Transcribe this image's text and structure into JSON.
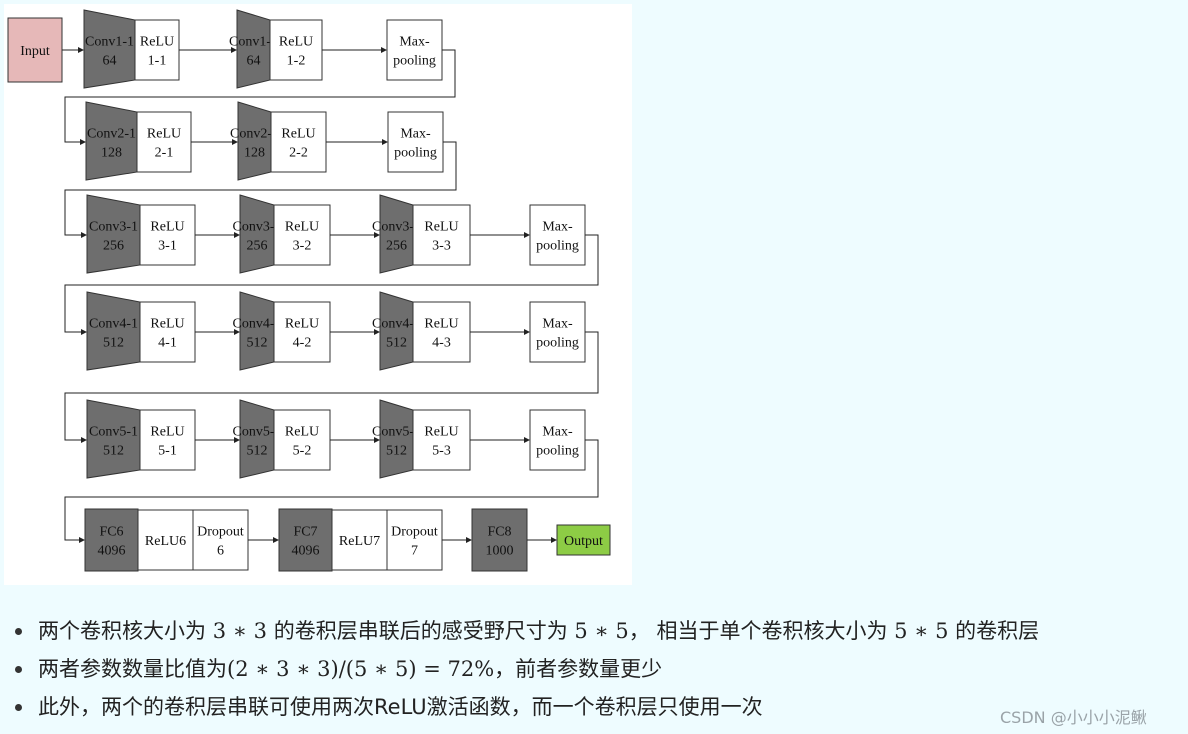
{
  "diagram": {
    "rows": [
      [
        {
          "type": "input",
          "lines": [
            "Input"
          ]
        },
        {
          "type": "conv",
          "lines": [
            "Conv1-1",
            "64"
          ]
        },
        {
          "type": "relu",
          "lines": [
            "ReLU",
            "1-1"
          ]
        },
        {
          "type": "conv",
          "lines": [
            "Conv1-2",
            "64"
          ]
        },
        {
          "type": "relu",
          "lines": [
            "ReLU",
            "1-2"
          ]
        },
        {
          "type": "pool",
          "lines": [
            "Max-",
            "pooling"
          ]
        }
      ],
      [
        {
          "type": "conv",
          "lines": [
            "Conv2-1",
            "128"
          ]
        },
        {
          "type": "relu",
          "lines": [
            "ReLU",
            "2-1"
          ]
        },
        {
          "type": "conv",
          "lines": [
            "Conv2-2",
            "128"
          ]
        },
        {
          "type": "relu",
          "lines": [
            "ReLU",
            "2-2"
          ]
        },
        {
          "type": "pool",
          "lines": [
            "Max-",
            "pooling"
          ]
        }
      ],
      [
        {
          "type": "conv",
          "lines": [
            "Conv3-1",
            "256"
          ]
        },
        {
          "type": "relu",
          "lines": [
            "ReLU",
            "3-1"
          ]
        },
        {
          "type": "conv",
          "lines": [
            "Conv3-2",
            "256"
          ]
        },
        {
          "type": "relu",
          "lines": [
            "ReLU",
            "3-2"
          ]
        },
        {
          "type": "conv",
          "lines": [
            "Conv3-3",
            "256"
          ]
        },
        {
          "type": "relu",
          "lines": [
            "ReLU",
            "3-3"
          ]
        },
        {
          "type": "pool",
          "lines": [
            "Max-",
            "pooling"
          ]
        }
      ],
      [
        {
          "type": "conv",
          "lines": [
            "Conv4-1",
            "512"
          ]
        },
        {
          "type": "relu",
          "lines": [
            "ReLU",
            "4-1"
          ]
        },
        {
          "type": "conv",
          "lines": [
            "Conv4-2",
            "512"
          ]
        },
        {
          "type": "relu",
          "lines": [
            "ReLU",
            "4-2"
          ]
        },
        {
          "type": "conv",
          "lines": [
            "Conv4-3",
            "512"
          ]
        },
        {
          "type": "relu",
          "lines": [
            "ReLU",
            "4-3"
          ]
        },
        {
          "type": "pool",
          "lines": [
            "Max-",
            "pooling"
          ]
        }
      ],
      [
        {
          "type": "conv",
          "lines": [
            "Conv5-1",
            "512"
          ]
        },
        {
          "type": "relu",
          "lines": [
            "ReLU",
            "5-1"
          ]
        },
        {
          "type": "conv",
          "lines": [
            "Conv5-2",
            "512"
          ]
        },
        {
          "type": "relu",
          "lines": [
            "ReLU",
            "5-2"
          ]
        },
        {
          "type": "conv",
          "lines": [
            "Conv5-3",
            "512"
          ]
        },
        {
          "type": "relu",
          "lines": [
            "ReLU",
            "5-3"
          ]
        },
        {
          "type": "pool",
          "lines": [
            "Max-",
            "pooling"
          ]
        }
      ],
      [
        {
          "type": "fc",
          "lines": [
            "FC6",
            "4096"
          ]
        },
        {
          "type": "relu",
          "lines": [
            "ReLU6"
          ]
        },
        {
          "type": "relu",
          "lines": [
            "Dropout",
            "6"
          ]
        },
        {
          "type": "fc",
          "lines": [
            "FC7",
            "4096"
          ]
        },
        {
          "type": "relu",
          "lines": [
            "ReLU7"
          ]
        },
        {
          "type": "relu",
          "lines": [
            "Dropout",
            "7"
          ]
        },
        {
          "type": "fc",
          "lines": [
            "FC8",
            "1000"
          ]
        },
        {
          "type": "output",
          "lines": [
            "Output"
          ]
        }
      ]
    ],
    "colors": {
      "conv": "#6e6e6e",
      "input": "#e6b8b8",
      "output": "#8dcc45",
      "box": "#ffffff"
    }
  },
  "bullets": [
    {
      "pre": "两个卷积核大小为 ",
      "m1": "3 ∗ 3",
      "mid": " 的卷积层串联后的感受野尺寸为 ",
      "m2": "5 ∗ 5",
      "mid2": "， 相当于单个卷积核大小为 ",
      "m3": "5 ∗ 5",
      "post": " 的卷积层"
    },
    {
      "pre": "两者参数数量比值为",
      "m1": "(2 ∗ 3 ∗ 3)/(5 ∗ 5) = 72%",
      "post": "，前者参数量更少"
    },
    {
      "pre": "此外，两个的卷积层串联可使用两次ReLU激活函数，而一个卷积层只使用一次"
    }
  ],
  "watermark": "CSDN @小小小泥鳅"
}
